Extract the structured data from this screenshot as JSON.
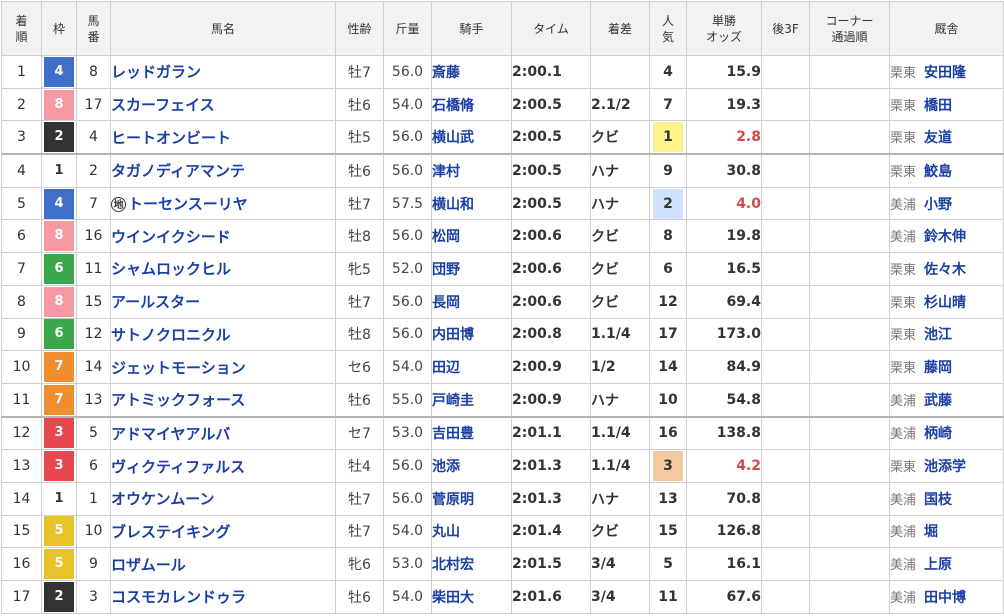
{
  "headers": {
    "rank": [
      "着",
      "順"
    ],
    "frame": "枠",
    "num": [
      "馬",
      "番"
    ],
    "name": "馬名",
    "sexage": "性齢",
    "weight": "斤量",
    "jockey": "騎手",
    "time": "タイム",
    "margin": "着差",
    "pop": [
      "人",
      "気"
    ],
    "odds": [
      "単勝",
      "オッズ"
    ],
    "last3f": "後3F",
    "corner": [
      "コーナー",
      "通過順"
    ],
    "trainer": "厩舎"
  },
  "frame_colors": {
    "1": {
      "bg": "#ffffff",
      "fg": "#333333"
    },
    "2": {
      "bg": "#333333",
      "fg": "#ffffff"
    },
    "3": {
      "bg": "#e8474f",
      "fg": "#ffffff"
    },
    "4": {
      "bg": "#3e6fc9",
      "fg": "#ffffff"
    },
    "5": {
      "bg": "#e6c32a",
      "fg": "#ffffff"
    },
    "6": {
      "bg": "#3aa84a",
      "fg": "#ffffff"
    },
    "7": {
      "bg": "#f08d2f",
      "fg": "#ffffff"
    },
    "8": {
      "bg": "#f59aa4",
      "fg": "#ffffff"
    }
  },
  "pop_highlight_colors": {
    "1": "#fff28a",
    "2": "#cfe2fb",
    "3": "#f6caa1"
  },
  "rows": [
    {
      "rank": "1",
      "frame": "4",
      "num": "8",
      "name": "レッドガラン",
      "chihou": "",
      "sexage": "牡7",
      "weight": "56.0",
      "jockey": "斎藤",
      "time": "2:00.1",
      "margin": "",
      "pop": "4",
      "odds": "15.9",
      "last3f": "",
      "corner": "",
      "region": "栗東",
      "trainer": "安田隆"
    },
    {
      "rank": "2",
      "frame": "8",
      "num": "17",
      "name": "スカーフェイス",
      "chihou": "",
      "sexage": "牡6",
      "weight": "54.0",
      "jockey": "石橋脩",
      "time": "2:00.5",
      "margin": "2.1/2",
      "pop": "7",
      "odds": "19.3",
      "last3f": "",
      "corner": "",
      "region": "栗東",
      "trainer": "橋田"
    },
    {
      "rank": "3",
      "frame": "2",
      "num": "4",
      "name": "ヒートオンビート",
      "chihou": "",
      "sexage": "牡5",
      "weight": "56.0",
      "jockey": "横山武",
      "time": "2:00.5",
      "margin": "クビ",
      "pop": "1",
      "odds": "2.8",
      "last3f": "",
      "corner": "",
      "region": "栗東",
      "trainer": "友道"
    },
    {
      "rank": "4",
      "frame": "1",
      "num": "2",
      "name": "タガノディアマンテ",
      "chihou": "",
      "sexage": "牡6",
      "weight": "56.0",
      "jockey": "津村",
      "time": "2:00.5",
      "margin": "ハナ",
      "pop": "9",
      "odds": "30.8",
      "last3f": "",
      "corner": "",
      "region": "栗東",
      "trainer": "鮫島"
    },
    {
      "rank": "5",
      "frame": "4",
      "num": "7",
      "name": "トーセンスーリヤ",
      "chihou": "地",
      "sexage": "牡7",
      "weight": "57.5",
      "jockey": "横山和",
      "time": "2:00.5",
      "margin": "ハナ",
      "pop": "2",
      "odds": "4.0",
      "last3f": "",
      "corner": "",
      "region": "美浦",
      "trainer": "小野"
    },
    {
      "rank": "6",
      "frame": "8",
      "num": "16",
      "name": "ウインイクシード",
      "chihou": "",
      "sexage": "牡8",
      "weight": "56.0",
      "jockey": "松岡",
      "time": "2:00.6",
      "margin": "クビ",
      "pop": "8",
      "odds": "19.8",
      "last3f": "",
      "corner": "",
      "region": "美浦",
      "trainer": "鈴木伸"
    },
    {
      "rank": "7",
      "frame": "6",
      "num": "11",
      "name": "シャムロックヒル",
      "chihou": "",
      "sexage": "牝5",
      "weight": "52.0",
      "jockey": "団野",
      "time": "2:00.6",
      "margin": "クビ",
      "pop": "6",
      "odds": "16.5",
      "last3f": "",
      "corner": "",
      "region": "栗東",
      "trainer": "佐々木"
    },
    {
      "rank": "8",
      "frame": "8",
      "num": "15",
      "name": "アールスター",
      "chihou": "",
      "sexage": "牡7",
      "weight": "56.0",
      "jockey": "長岡",
      "time": "2:00.6",
      "margin": "クビ",
      "pop": "12",
      "odds": "69.4",
      "last3f": "",
      "corner": "",
      "region": "栗東",
      "trainer": "杉山晴"
    },
    {
      "rank": "9",
      "frame": "6",
      "num": "12",
      "name": "サトノクロニクル",
      "chihou": "",
      "sexage": "牡8",
      "weight": "56.0",
      "jockey": "内田博",
      "time": "2:00.8",
      "margin": "1.1/4",
      "pop": "17",
      "odds": "173.0",
      "last3f": "",
      "corner": "",
      "region": "栗東",
      "trainer": "池江"
    },
    {
      "rank": "10",
      "frame": "7",
      "num": "14",
      "name": "ジェットモーション",
      "chihou": "",
      "sexage": "セ6",
      "weight": "54.0",
      "jockey": "田辺",
      "time": "2:00.9",
      "margin": "1/2",
      "pop": "14",
      "odds": "84.9",
      "last3f": "",
      "corner": "",
      "region": "栗東",
      "trainer": "藤岡"
    },
    {
      "rank": "11",
      "frame": "7",
      "num": "13",
      "name": "アトミックフォース",
      "chihou": "",
      "sexage": "牡6",
      "weight": "55.0",
      "jockey": "戸崎圭",
      "time": "2:00.9",
      "margin": "ハナ",
      "pop": "10",
      "odds": "54.8",
      "last3f": "",
      "corner": "",
      "region": "美浦",
      "trainer": "武藤"
    },
    {
      "rank": "12",
      "frame": "3",
      "num": "5",
      "name": "アドマイヤアルバ",
      "chihou": "",
      "sexage": "セ7",
      "weight": "53.0",
      "jockey": "吉田豊",
      "time": "2:01.1",
      "margin": "1.1/4",
      "pop": "16",
      "odds": "138.8",
      "last3f": "",
      "corner": "",
      "region": "美浦",
      "trainer": "柄崎"
    },
    {
      "rank": "13",
      "frame": "3",
      "num": "6",
      "name": "ヴィクティファルス",
      "chihou": "",
      "sexage": "牡4",
      "weight": "56.0",
      "jockey": "池添",
      "time": "2:01.3",
      "margin": "1.1/4",
      "pop": "3",
      "odds": "4.2",
      "last3f": "",
      "corner": "",
      "region": "栗東",
      "trainer": "池添学"
    },
    {
      "rank": "14",
      "frame": "1",
      "num": "1",
      "name": "オウケンムーン",
      "chihou": "",
      "sexage": "牡7",
      "weight": "56.0",
      "jockey": "菅原明",
      "time": "2:01.3",
      "margin": "ハナ",
      "pop": "13",
      "odds": "70.8",
      "last3f": "",
      "corner": "",
      "region": "美浦",
      "trainer": "国枝"
    },
    {
      "rank": "15",
      "frame": "5",
      "num": "10",
      "name": "ブレステイキング",
      "chihou": "",
      "sexage": "牡7",
      "weight": "54.0",
      "jockey": "丸山",
      "time": "2:01.4",
      "margin": "クビ",
      "pop": "15",
      "odds": "126.8",
      "last3f": "",
      "corner": "",
      "region": "美浦",
      "trainer": "堀"
    },
    {
      "rank": "16",
      "frame": "5",
      "num": "9",
      "name": "ロザムール",
      "chihou": "",
      "sexage": "牝6",
      "weight": "53.0",
      "jockey": "北村宏",
      "time": "2:01.5",
      "margin": "3/4",
      "pop": "5",
      "odds": "16.1",
      "last3f": "",
      "corner": "",
      "region": "美浦",
      "trainer": "上原"
    },
    {
      "rank": "17",
      "frame": "2",
      "num": "3",
      "name": "コスモカレンドゥラ",
      "chihou": "",
      "sexage": "牡6",
      "weight": "54.0",
      "jockey": "柴田大",
      "time": "2:01.6",
      "margin": "3/4",
      "pop": "11",
      "odds": "67.6",
      "last3f": "",
      "corner": "",
      "region": "美浦",
      "trainer": "田中博"
    }
  ]
}
